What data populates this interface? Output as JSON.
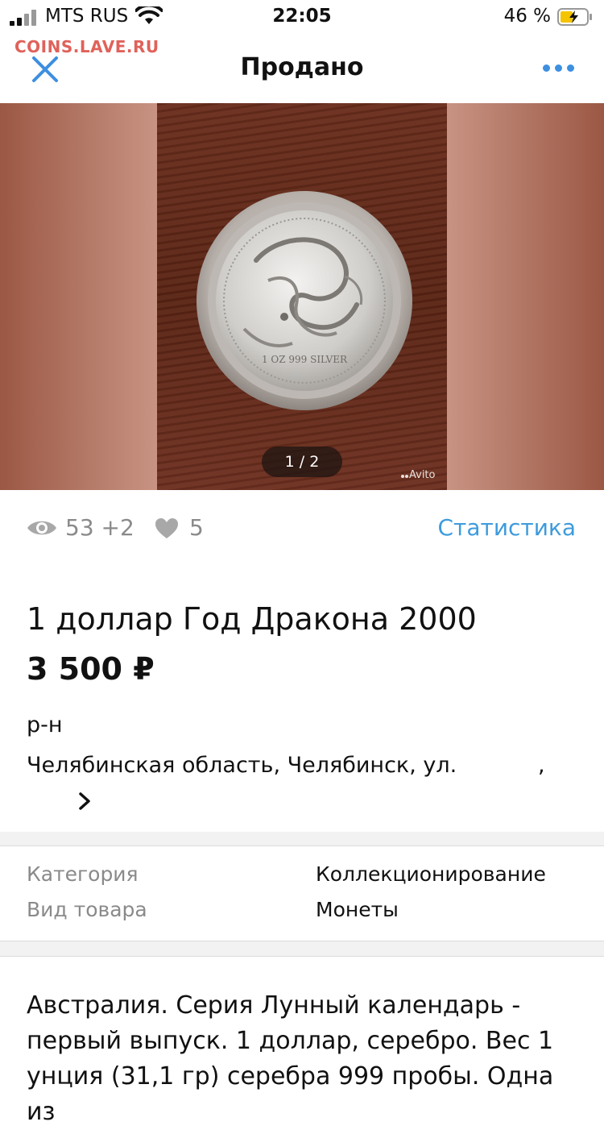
{
  "status_bar": {
    "carrier": "MTS RUS",
    "time": "22:05",
    "battery": "46 %"
  },
  "watermark": "COINS.LAVE.RU",
  "nav": {
    "title": "Продано"
  },
  "gallery": {
    "counter": "1 / 2",
    "brand": "Avito",
    "coin_text": "1 OZ 999 SILVER"
  },
  "stats": {
    "views": "53 +2",
    "likes": "5",
    "link": "Статистика"
  },
  "listing": {
    "title": "1 доллар Год Дракона 2000",
    "price": "3 500 ₽",
    "address_line1": "р-н",
    "address_line2": "Челябинская область, Челябинск, ул.",
    "address_comma": ","
  },
  "details": [
    {
      "label": "Категория",
      "value": "Коллекционирование"
    },
    {
      "label": "Вид товара",
      "value": "Монеты"
    }
  ],
  "description": "Австралия. Серия Лунный календарь - первый выпуск. 1 доллар, серебро. Вес 1 унция (31,1 гр) серебра 999 пробы. Одна из"
}
